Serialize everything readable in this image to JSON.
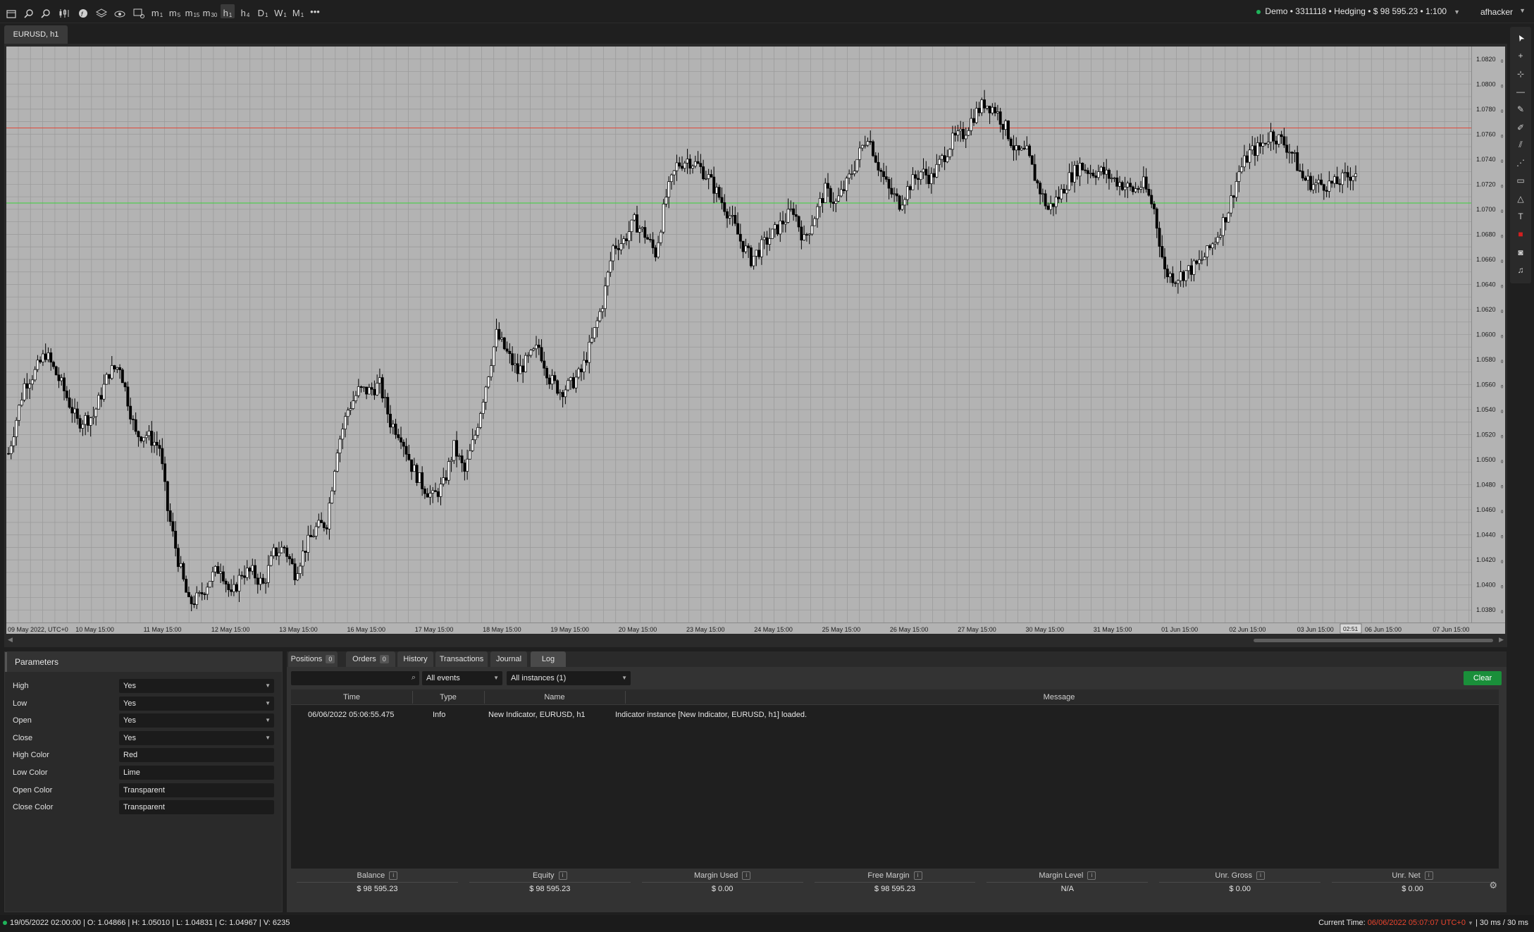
{
  "toolbar": {
    "icons": [
      "layout-icon",
      "zoom-in-icon",
      "zoom-out-icon",
      "chart-type-icon",
      "indicator-icon",
      "layers-icon",
      "eye-icon",
      "chart-settings-icon"
    ],
    "timeframes": [
      {
        "main": "m",
        "sub": "1",
        "active": false
      },
      {
        "main": "m",
        "sub": "5",
        "active": false
      },
      {
        "main": "m",
        "sub": "15",
        "active": false
      },
      {
        "main": "m",
        "sub": "30",
        "active": false
      },
      {
        "main": "h",
        "sub": "1",
        "active": true
      },
      {
        "main": "h",
        "sub": "4",
        "active": false
      },
      {
        "main": "D",
        "sub": "1",
        "active": false
      },
      {
        "main": "W",
        "sub": "1",
        "active": false
      },
      {
        "main": "M",
        "sub": "1",
        "active": false
      }
    ],
    "more": "•••"
  },
  "account": {
    "summary": "Demo • 3311118 • Hedging • $ 98 595.23 • 1:100",
    "user": "afhacker",
    "caret": "▼"
  },
  "chart": {
    "tab": "EURUSD, h1",
    "price_labels": [
      "1.0820",
      "1.0800",
      "1.0780",
      "1.0760",
      "1.0740",
      "1.0720",
      "1.0700",
      "1.0680",
      "1.0660",
      "1.0640",
      "1.0620",
      "1.0600",
      "1.0580",
      "1.0560",
      "1.0540",
      "1.0520",
      "1.0500",
      "1.0480",
      "1.0460",
      "1.0440",
      "1.0420",
      "1.0400",
      "1.0380"
    ],
    "price_suffix": "0",
    "time_labels": [
      "09 May 2022, UTC+0",
      "10 May 15:00",
      "11 May 15:00",
      "12 May 15:00",
      "13 May 15:00",
      "16 May 15:00",
      "17 May 15:00",
      "18 May 15:00",
      "19 May 15:00",
      "20 May 15:00",
      "23 May 15:00",
      "24 May 15:00",
      "25 May 15:00",
      "26 May 15:00",
      "27 May 15:00",
      "30 May 15:00",
      "31 May 15:00",
      "01 Jun 15:00",
      "02 Jun 15:00",
      "03 Jun 15:00",
      "06 Jun 15:00",
      "07 Jun 15:00"
    ],
    "cursor_label": "02:51",
    "colors": {
      "background": "#b3b3b3",
      "grid": "#9c9c9c",
      "candle": "#000000",
      "high_line": "#e0493a",
      "low_line": "#39d23a"
    }
  },
  "chart_data": {
    "type": "candlestick",
    "symbol": "EURUSD",
    "timeframe": "h1",
    "ylim": [
      1.037,
      1.083
    ],
    "high_line": 1.0765,
    "low_line": 1.0705,
    "price_path": [
      [
        0,
        1.0505
      ],
      [
        6,
        1.056
      ],
      [
        10,
        1.057
      ],
      [
        14,
        1.0585
      ],
      [
        20,
        1.056
      ],
      [
        26,
        1.053
      ],
      [
        32,
        1.0535
      ],
      [
        38,
        1.057
      ],
      [
        42,
        1.0575
      ],
      [
        48,
        1.052
      ],
      [
        52,
        1.052
      ],
      [
        57,
        1.051
      ],
      [
        60,
        1.046
      ],
      [
        64,
        1.042
      ],
      [
        68,
        1.0385
      ],
      [
        72,
        1.039
      ],
      [
        76,
        1.0405
      ],
      [
        80,
        1.0415
      ],
      [
        84,
        1.039
      ],
      [
        88,
        1.041
      ],
      [
        92,
        1.041
      ],
      [
        96,
        1.04
      ],
      [
        100,
        1.0425
      ],
      [
        104,
        1.043
      ],
      [
        108,
        1.041
      ],
      [
        112,
        1.043
      ],
      [
        116,
        1.0445
      ],
      [
        120,
        1.045
      ],
      [
        124,
        1.051
      ],
      [
        128,
        1.054
      ],
      [
        132,
        1.0555
      ],
      [
        136,
        1.0555
      ],
      [
        140,
        1.056
      ],
      [
        144,
        1.053
      ],
      [
        148,
        1.052
      ],
      [
        152,
        1.0495
      ],
      [
        156,
        1.048
      ],
      [
        160,
        1.047
      ],
      [
        164,
        1.048
      ],
      [
        168,
        1.051
      ],
      [
        172,
        1.049
      ],
      [
        176,
        1.052
      ],
      [
        180,
        1.056
      ],
      [
        184,
        1.06
      ],
      [
        188,
        1.0585
      ],
      [
        192,
        1.057
      ],
      [
        196,
        1.058
      ],
      [
        200,
        1.059
      ],
      [
        204,
        1.0565
      ],
      [
        208,
        1.0555
      ],
      [
        212,
        1.056
      ],
      [
        216,
        1.057
      ],
      [
        220,
        1.0595
      ],
      [
        224,
        1.0625
      ],
      [
        228,
        1.067
      ],
      [
        232,
        1.0675
      ],
      [
        236,
        1.069
      ],
      [
        240,
        1.068
      ],
      [
        244,
        1.0665
      ],
      [
        248,
        1.071
      ],
      [
        252,
        1.0735
      ],
      [
        256,
        1.074
      ],
      [
        260,
        1.0735
      ],
      [
        264,
        1.0725
      ],
      [
        268,
        1.071
      ],
      [
        272,
        1.0695
      ],
      [
        276,
        1.0675
      ],
      [
        280,
        1.066
      ],
      [
        284,
        1.067
      ],
      [
        288,
        1.068
      ],
      [
        292,
        1.069
      ],
      [
        296,
        1.07
      ],
      [
        300,
        1.0675
      ],
      [
        304,
        1.0695
      ],
      [
        308,
        1.0715
      ],
      [
        312,
        1.0705
      ],
      [
        316,
        1.072
      ],
      [
        320,
        1.074
      ],
      [
        324,
        1.076
      ],
      [
        328,
        1.0735
      ],
      [
        332,
        1.0715
      ],
      [
        336,
        1.0705
      ],
      [
        340,
        1.072
      ],
      [
        344,
        1.073
      ],
      [
        348,
        1.0725
      ],
      [
        352,
        1.074
      ],
      [
        356,
        1.0755
      ],
      [
        360,
        1.076
      ],
      [
        364,
        1.0775
      ],
      [
        368,
        1.0785
      ],
      [
        372,
        1.078
      ],
      [
        376,
        1.0765
      ],
      [
        380,
        1.0745
      ],
      [
        384,
        1.0745
      ],
      [
        388,
        1.072
      ],
      [
        392,
        1.07
      ],
      [
        396,
        1.071
      ],
      [
        400,
        1.0725
      ],
      [
        404,
        1.0735
      ],
      [
        408,
        1.073
      ],
      [
        412,
        1.073
      ],
      [
        416,
        1.0725
      ],
      [
        420,
        1.072
      ],
      [
        424,
        1.0715
      ],
      [
        428,
        1.072
      ],
      [
        432,
        1.07
      ],
      [
        436,
        1.065
      ],
      [
        440,
        1.0645
      ],
      [
        444,
        1.065
      ],
      [
        448,
        1.0655
      ],
      [
        452,
        1.0665
      ],
      [
        456,
        1.068
      ],
      [
        460,
        1.07
      ],
      [
        464,
        1.073
      ],
      [
        468,
        1.0745
      ],
      [
        472,
        1.075
      ],
      [
        476,
        1.076
      ],
      [
        480,
        1.0755
      ],
      [
        484,
        1.0745
      ],
      [
        488,
        1.0725
      ],
      [
        492,
        1.072
      ],
      [
        496,
        1.072
      ],
      [
        500,
        1.072
      ],
      [
        504,
        1.0725
      ],
      [
        508,
        1.073
      ]
    ]
  },
  "right_tools": [
    "cursor-icon",
    "crosshair-icon",
    "measure-icon",
    "horizontal-line-icon",
    "pencil-icon",
    "brush-icon",
    "fib-icon",
    "channel-icon",
    "rectangle-icon",
    "triangle-icon",
    "text-icon",
    "color-swatch-icon",
    "camera-icon",
    "bell-icon"
  ],
  "params": {
    "title": "Parameters",
    "rows": [
      {
        "label": "High",
        "value": "Yes",
        "dropdown": true
      },
      {
        "label": "Low",
        "value": "Yes",
        "dropdown": true
      },
      {
        "label": "Open",
        "value": "Yes",
        "dropdown": true
      },
      {
        "label": "Close",
        "value": "Yes",
        "dropdown": true
      },
      {
        "label": "High Color",
        "value": "Red",
        "dropdown": false
      },
      {
        "label": "Low Color",
        "value": "Lime",
        "dropdown": false
      },
      {
        "label": "Open Color",
        "value": "Transparent",
        "dropdown": false
      },
      {
        "label": "Close Color",
        "value": "Transparent",
        "dropdown": false
      }
    ]
  },
  "bottom": {
    "tabs": [
      {
        "label": "Positions",
        "badge": "0",
        "active": false
      },
      {
        "label": "Orders",
        "badge": "0",
        "active": false
      },
      {
        "label": "History",
        "badge": "",
        "active": false
      },
      {
        "label": "Transactions",
        "badge": "",
        "active": false
      },
      {
        "label": "Journal",
        "badge": "",
        "active": false
      },
      {
        "label": "Log",
        "badge": "",
        "active": true
      }
    ],
    "search_placeholder": "",
    "filter_events": "All events",
    "filter_instances": "All instances (1)",
    "clear": "Clear",
    "columns": [
      "Time",
      "Type",
      "Name",
      "Message"
    ],
    "rows": [
      {
        "time": "06/06/2022 05:06:55.475",
        "type": "Info",
        "name": "New Indicator, EURUSD, h1",
        "message": "Indicator instance [New Indicator, EURUSD, h1] loaded."
      }
    ],
    "stats": [
      {
        "label": "Balance",
        "value": "$ 98 595.23"
      },
      {
        "label": "Equity",
        "value": "$ 98 595.23"
      },
      {
        "label": "Margin Used",
        "value": "$ 0.00"
      },
      {
        "label": "Free Margin",
        "value": "$ 98 595.23"
      },
      {
        "label": "Margin Level",
        "value": "N/A"
      },
      {
        "label": "Unr. Gross",
        "value": "$ 0.00"
      },
      {
        "label": "Unr. Net",
        "value": "$ 0.00"
      }
    ]
  },
  "status": {
    "ohlc": "19/05/2022 02:00:00 | O: 1.04866 | H: 1.05010 | L: 1.04831 | C: 1.04967 | V: 6235",
    "current_time_label": "Current Time:",
    "current_time": "06/06/2022 05:07:07",
    "timezone": "UTC+0",
    "latency": "| 30 ms / 30 ms"
  }
}
